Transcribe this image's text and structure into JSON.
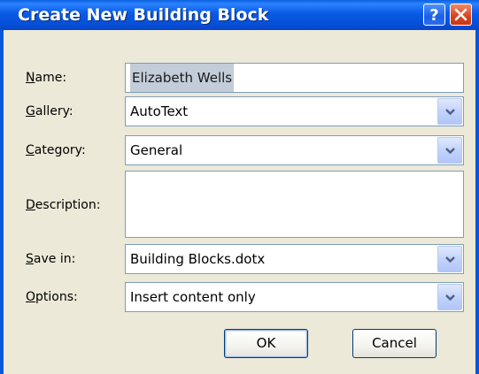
{
  "dialog": {
    "title": "Create New Building Block",
    "help_button_icon": "help-icon",
    "close_button_icon": "close-icon"
  },
  "fields": {
    "name": {
      "label_mnemonic": "N",
      "label_rest": "ame:",
      "value": "Elizabeth Wells"
    },
    "gallery": {
      "label_mnemonic": "G",
      "label_rest": "allery:",
      "value": "AutoText"
    },
    "category": {
      "label_mnemonic": "C",
      "label_rest": "ategory:",
      "value": "General"
    },
    "description": {
      "label_mnemonic": "D",
      "label_rest": "escription:",
      "value": ""
    },
    "save_in": {
      "label_mnemonic": "S",
      "label_rest": "ave in:",
      "value": "Building Blocks.dotx"
    },
    "options": {
      "label_mnemonic": "O",
      "label_rest": "ptions:",
      "value": "Insert content only"
    }
  },
  "buttons": {
    "ok": "OK",
    "cancel": "Cancel"
  },
  "colors": {
    "titlebar": "#0a5ae4",
    "dialog_bg": "#ece9d8",
    "field_border": "#7f9db9",
    "selection": "#c3ccd9"
  }
}
